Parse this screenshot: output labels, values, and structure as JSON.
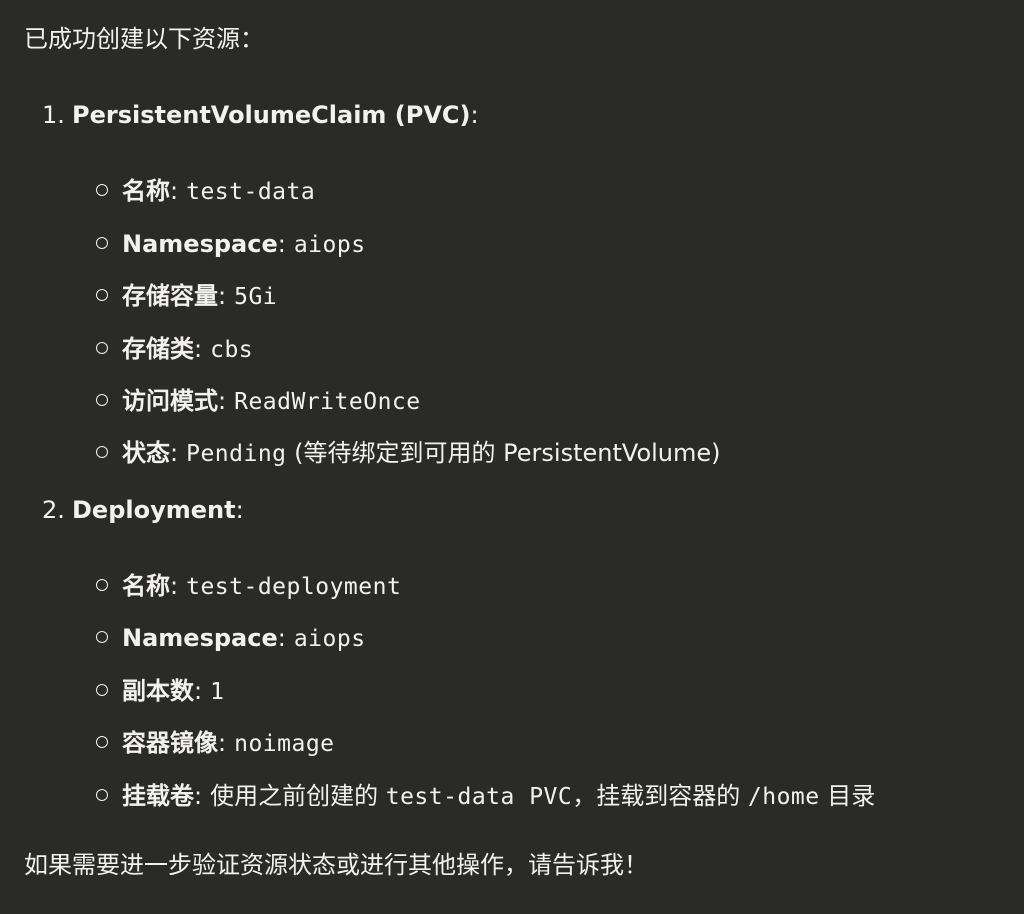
{
  "message": {
    "intro": "已成功创建以下资源：",
    "sections": [
      {
        "number": "1.",
        "title": "PersistentVolumeClaim (PVC)",
        "title_suffix": ":",
        "items": [
          {
            "label": "名称",
            "sep": ":",
            "value": "test-data",
            "note": ""
          },
          {
            "label": "Namespace",
            "sep": ":",
            "value": "aiops",
            "note": ""
          },
          {
            "label": "存储容量",
            "sep": ":",
            "value": "5Gi",
            "note": ""
          },
          {
            "label": "存储类",
            "sep": ":",
            "value": "cbs",
            "note": ""
          },
          {
            "label": "访问模式",
            "sep": ":",
            "value": "ReadWriteOnce",
            "note": ""
          },
          {
            "label": "状态",
            "sep": ":",
            "value": "Pending",
            "note": "(等待绑定到可用的 PersistentVolume)"
          }
        ]
      },
      {
        "number": "2.",
        "title": "Deployment",
        "title_suffix": ":",
        "items": [
          {
            "label": "名称",
            "sep": ":",
            "value": "test-deployment"
          },
          {
            "label": "Namespace",
            "sep": ":",
            "value": "aiops"
          },
          {
            "label": "副本数",
            "sep": ":",
            "value": "1"
          },
          {
            "label": "容器镜像",
            "sep": ":",
            "value": "noimage"
          },
          {
            "label": "挂载卷",
            "sep": ":",
            "mount_text_1": "使用之前创建的",
            "mount_code_1": "test-data PVC",
            "mount_text_2": "，挂载到容器的",
            "mount_code_2": "/home",
            "mount_text_3": "目录"
          }
        ]
      }
    ],
    "outro": "如果需要进一步验证资源状态或进行其他操作，请告诉我！"
  },
  "colors": {
    "background": "#2a2a29",
    "text": "#f2f1ed"
  }
}
